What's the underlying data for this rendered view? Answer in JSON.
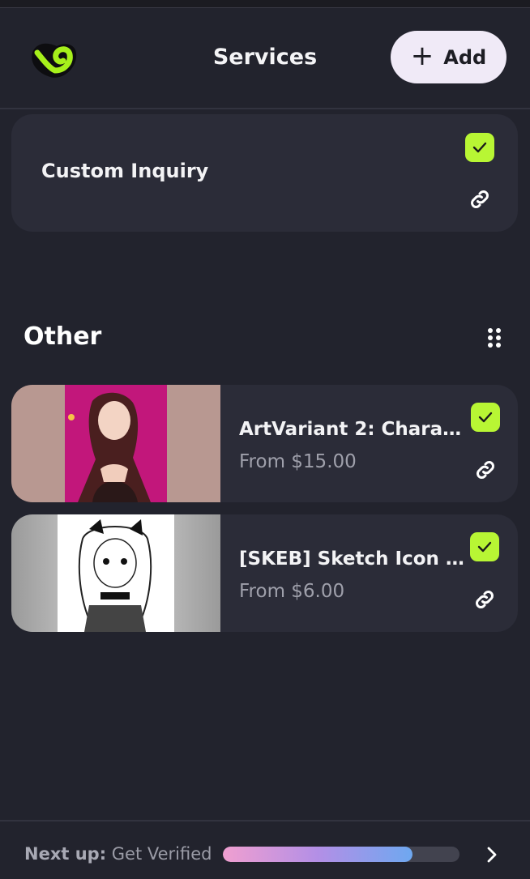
{
  "header": {
    "title": "Services",
    "add_label": "Add"
  },
  "custom_inquiry": {
    "name": "Custom Inquiry",
    "enabled": true
  },
  "section": {
    "title": "Other"
  },
  "services": [
    {
      "name": "ArtVariant 2: Characte...",
      "price": "From $15.00",
      "enabled": true
    },
    {
      "name": "[SKEB] Sketch Icon - ...",
      "price": "From $6.00",
      "enabled": true
    }
  ],
  "footer": {
    "next_label": "Next up:",
    "next_value": "Get Verified",
    "progress": 0.8
  },
  "colors": {
    "background": "#22232d",
    "card": "#2b2c38",
    "accent_green": "#b8f634",
    "add_button": "#f0eaf7"
  },
  "icons": {
    "logo": "brand-logo-icon",
    "add": "plus-icon",
    "check": "check-icon",
    "link": "link-icon",
    "drag": "drag-handle-icon",
    "next": "chevron-right-icon"
  }
}
